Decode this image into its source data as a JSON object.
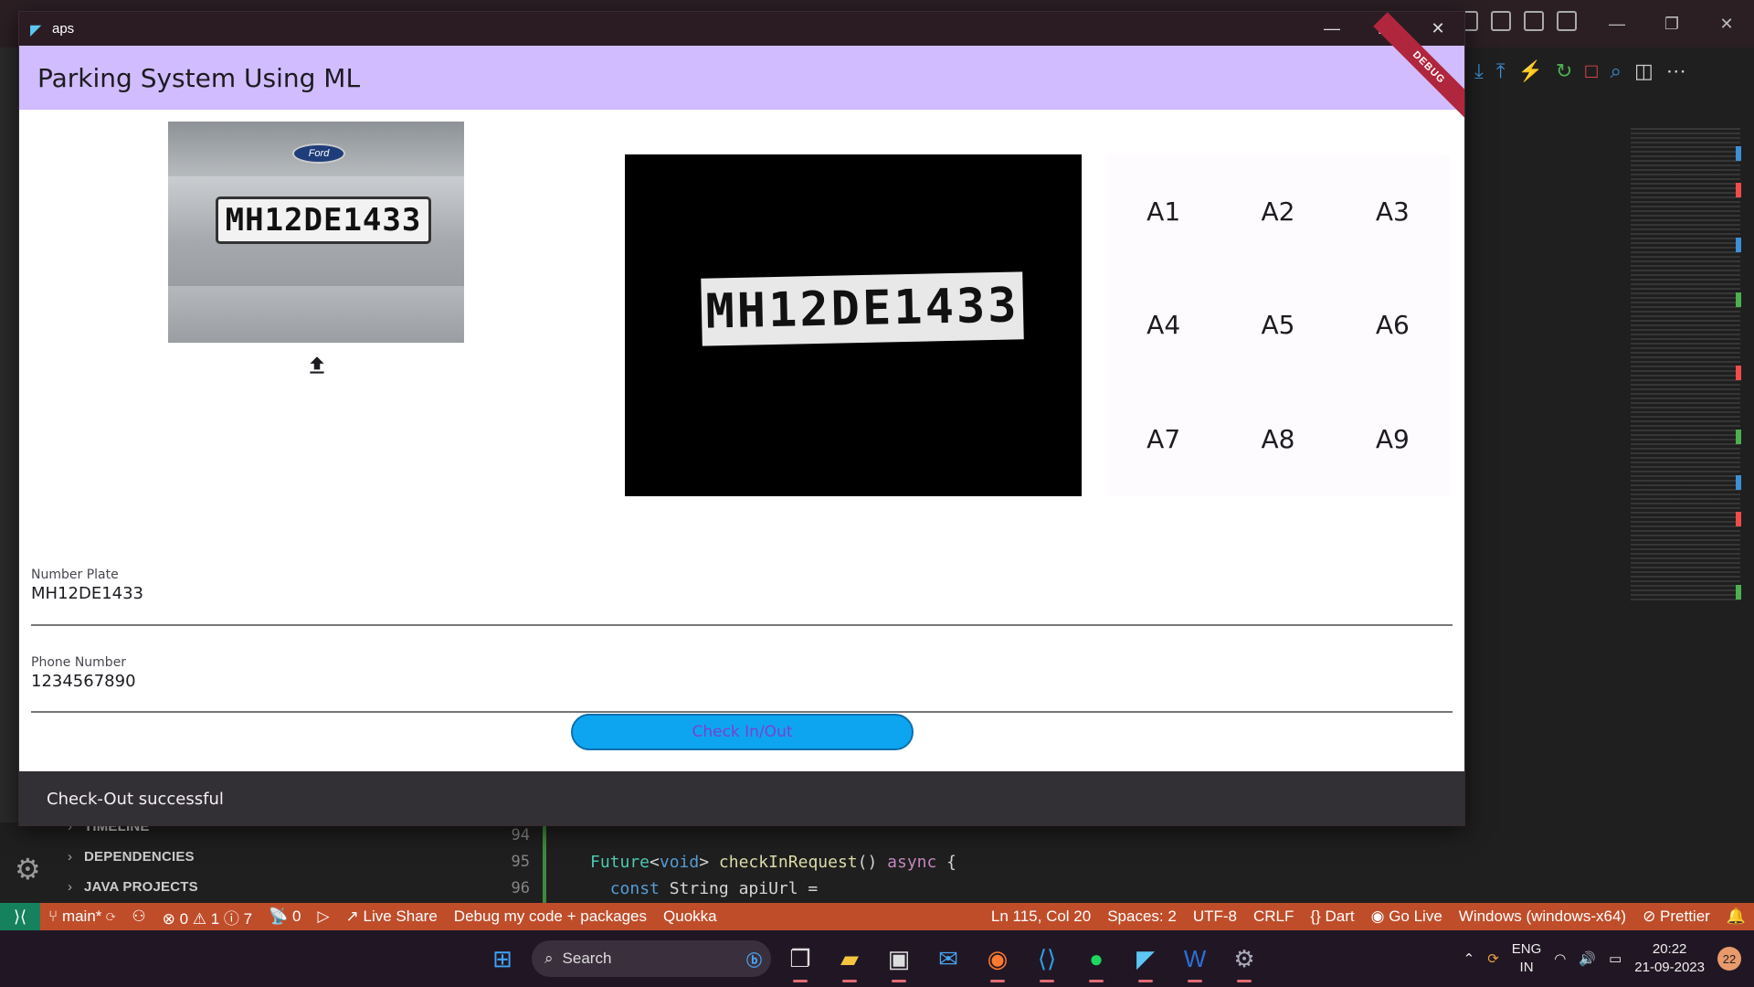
{
  "vscode": {
    "explorer_sections": [
      "TIMELINE",
      "DEPENDENCIES",
      "JAVA PROJECTS"
    ],
    "line_numbers": [
      "94",
      "95",
      "96"
    ],
    "code_line_95": {
      "kw_future": "Future",
      "lt": "<",
      "kw_void": "void",
      "gt": ">",
      "fn": " checkInRequest",
      "paren": "() ",
      "async": "async",
      "brace": " {"
    },
    "code_line_96": {
      "indent": "  ",
      "kw_const": "const",
      "rest": " String apiUrl ="
    },
    "statusbar": {
      "branch": "main*",
      "errors": "0",
      "warnings": "1",
      "infos": "7",
      "ports": "0",
      "live_share": "Live Share",
      "debug_config": "Debug my code + packages",
      "quokka": "Quokka",
      "cursor": "Ln 115, Col 20",
      "spaces": "Spaces: 2",
      "encoding": "UTF-8",
      "eol": "CRLF",
      "language": "Dart",
      "go_live": "Go Live",
      "device": "Windows (windows-x64)",
      "prettier": "Prettier"
    }
  },
  "taskbar": {
    "search_placeholder": "Search",
    "lang_line1": "ENG",
    "lang_line2": "IN",
    "time": "20:22",
    "date": "21-09-2023",
    "notification_count": "22"
  },
  "app": {
    "window_title": "aps",
    "appbar_title": "Parking System Using ML",
    "debug_banner": "DEBUG",
    "car_logo_text": "Ford",
    "car_plate_text": "MH12DE1433",
    "cropped_plate_text": "MH12DE1433",
    "slots": [
      "A1",
      "A2",
      "A3",
      "A4",
      "A5",
      "A6",
      "A7",
      "A8",
      "A9"
    ],
    "number_plate": {
      "label": "Number Plate",
      "value": "MH12DE1433"
    },
    "phone_number": {
      "label": "Phone Number",
      "value": "1234567890"
    },
    "button_label": "Check In/Out",
    "snackbar_message": "Check-Out successful"
  }
}
